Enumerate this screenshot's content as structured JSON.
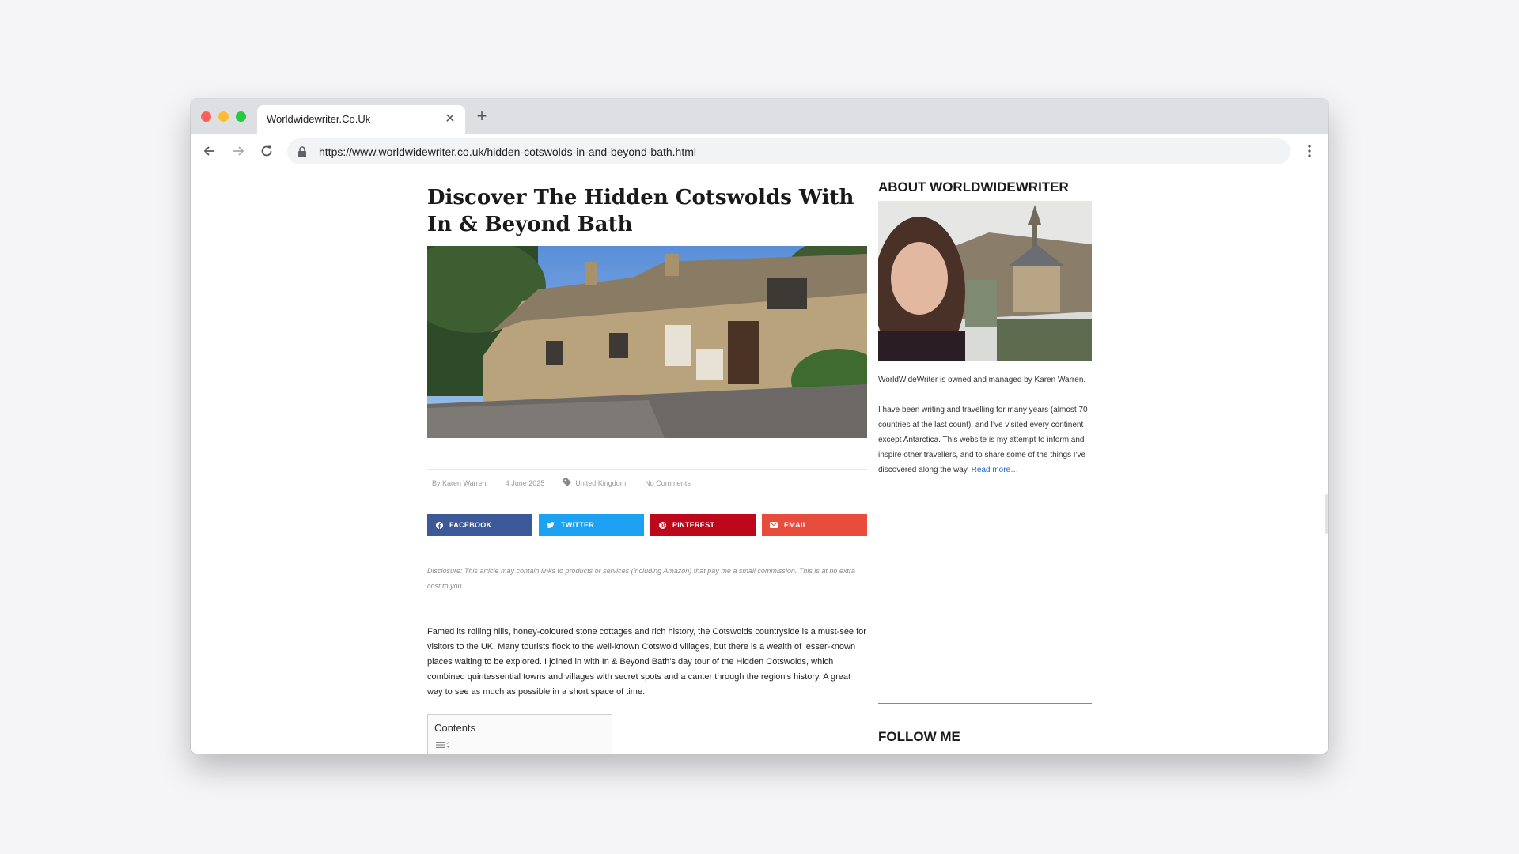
{
  "browser": {
    "tab_title": "Worldwidewriter.Co.Uk",
    "url": "https://www.worldwidewriter.co.uk/hidden-cotswolds-in-and-beyond-bath.html"
  },
  "article": {
    "title": "Discover The Hidden Cotswolds With In & Beyond Bath",
    "meta": {
      "author": "By Karen Warren",
      "date": "4 June 2025",
      "category": "United Kingdom",
      "comments": "No Comments"
    },
    "share_buttons": [
      {
        "label": "FACEBOOK",
        "icon": "facebook-icon",
        "color": "#3b5998"
      },
      {
        "label": "TWITTER",
        "icon": "twitter-icon",
        "color": "#1da1f2"
      },
      {
        "label": "PINTEREST",
        "icon": "pinterest-icon",
        "color": "#bd081c"
      },
      {
        "label": "EMAIL",
        "icon": "email-icon",
        "color": "#e84c3d"
      }
    ],
    "disclosure": "Disclosure: This article may contain links to products or services (including Amazon) that pay me a small commission. This is at no extra cost to you.",
    "intro": "Famed its rolling hills, honey-coloured stone cottages and rich history, the Cotswolds countryside is a must-see for visitors to the UK. Many tourists flock to the well-known Cotswold villages, but there is a wealth of lesser-known places waiting to be explored. I joined in with In & Beyond Bath's day tour of the Hidden Cotswolds, which combined quintessential towns and villages with secret spots and a canter through the region's history. A great way to see as much as possible in a short space of time.",
    "contents_title": "Contents"
  },
  "sidebar": {
    "about_heading": "ABOUT WORLDWIDEWRITER",
    "about_p1": "WorldWideWriter is owned and managed by Karen Warren.",
    "about_p2": "I have been writing and travelling for many years (almost 70 countries at the last count), and I've visited every continent except Antarctica. This website is my attempt to inform and inspire other travellers, and to share some of the things I've discovered along the way.",
    "read_more": "Read more…",
    "follow_heading": "FOLLOW ME"
  }
}
